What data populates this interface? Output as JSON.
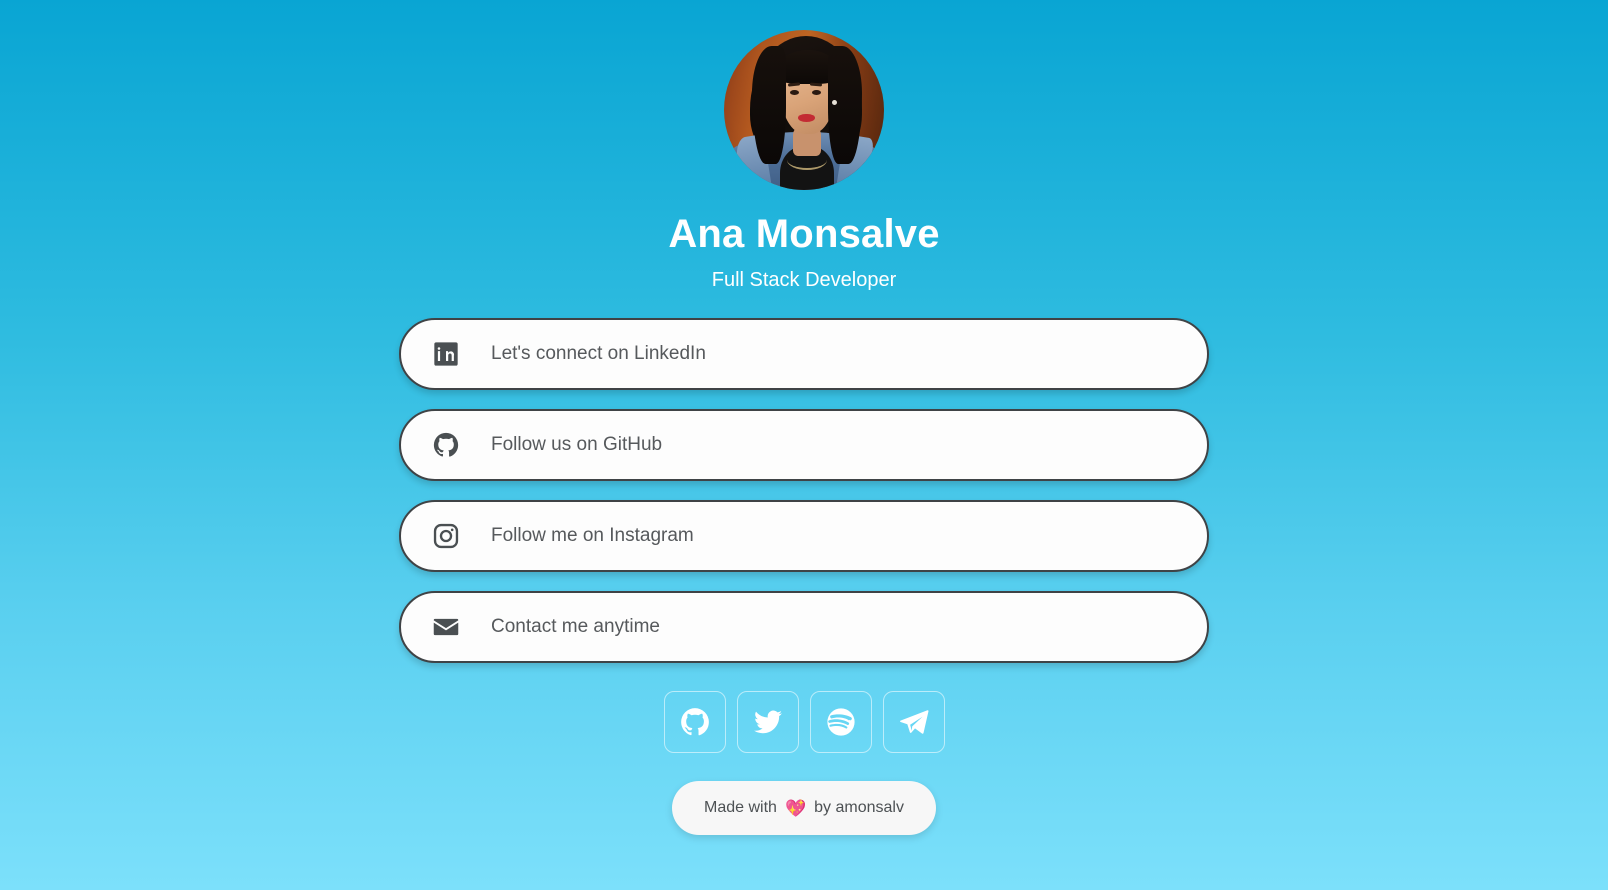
{
  "profile": {
    "avatar_alt": "avatar-photo",
    "name": "Ana Monsalve",
    "title": "Full Stack Developer"
  },
  "links": [
    {
      "icon": "linkedin-icon",
      "label": "Let's connect on LinkedIn"
    },
    {
      "icon": "github-icon",
      "label": "Follow us on GitHub"
    },
    {
      "icon": "instagram-icon",
      "label": "Follow me on Instagram"
    },
    {
      "icon": "email-icon",
      "label": "Contact me anytime"
    }
  ],
  "socials": [
    {
      "icon": "github-icon",
      "name": "GitHub"
    },
    {
      "icon": "twitter-icon",
      "name": "Twitter"
    },
    {
      "icon": "spotify-icon",
      "name": "Spotify"
    },
    {
      "icon": "telegram-icon",
      "name": "Telegram"
    }
  ],
  "footer": {
    "prefix": "Made with",
    "heart": "💖",
    "suffix": "by amonsalv"
  },
  "colors": {
    "gradient_top": "#09a5d3",
    "gradient_bottom": "#7ce0fb",
    "button_bg": "#fdfdfd",
    "button_border": "#3f4346",
    "button_text": "#56595c",
    "heading_text": "#ffffff"
  }
}
